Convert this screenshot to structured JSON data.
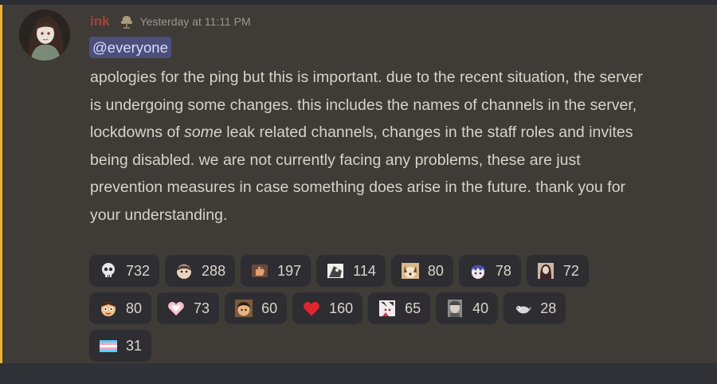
{
  "message": {
    "username": "ink",
    "timestamp": "Yesterday at 11:11 PM",
    "mention": "@everyone",
    "body": {
      "part1": "apologies for the ping but this is important. due to the recent situation, the server is undergoing some changes. this includes the names of channels in the server, lockdowns of ",
      "emphasis": "some",
      "part2": " leak related channels, changes in the staff roles and invites being disabled. we are not currently facing any problems, these are just prevention measures in case something does arise in the future. thank you for your understanding."
    }
  },
  "reactions": [
    {
      "emoji": "skull-emoji",
      "count": "732",
      "color": "#e8e8e8"
    },
    {
      "emoji": "anime-face-emoji",
      "count": "288",
      "color": "#c9a27a"
    },
    {
      "emoji": "hand-emoji",
      "count": "197",
      "color": "#d08a5a"
    },
    {
      "emoji": "manga-panel-emoji",
      "count": "114",
      "color": "#bdbdbd"
    },
    {
      "emoji": "dog-emoji",
      "count": "80",
      "color": "#c8a070"
    },
    {
      "emoji": "purple-hair-emoji",
      "count": "78",
      "color": "#6c6fc4"
    },
    {
      "emoji": "portrait-emoji",
      "count": "72",
      "color": "#8a6a5a"
    },
    {
      "emoji": "cartoon-face-emoji",
      "count": "80",
      "color": "#e0a070"
    },
    {
      "emoji": "pink-heart-emoji",
      "count": "73",
      "color": "#f2b3c8"
    },
    {
      "emoji": "boy-face-emoji",
      "count": "60",
      "color": "#c48a5a"
    },
    {
      "emoji": "red-heart-emoji",
      "count": "160",
      "color": "#e0303a"
    },
    {
      "emoji": "sketch-face-emoji",
      "count": "65",
      "color": "#d8c8c0"
    },
    {
      "emoji": "photo-face-emoji",
      "count": "40",
      "color": "#9a9a9a"
    },
    {
      "emoji": "small-creature-emoji",
      "count": "28",
      "color": "#c8c8c8"
    },
    {
      "emoji": "trans-flag-emoji",
      "count": "31",
      "color": "#7fc8f0"
    }
  ]
}
